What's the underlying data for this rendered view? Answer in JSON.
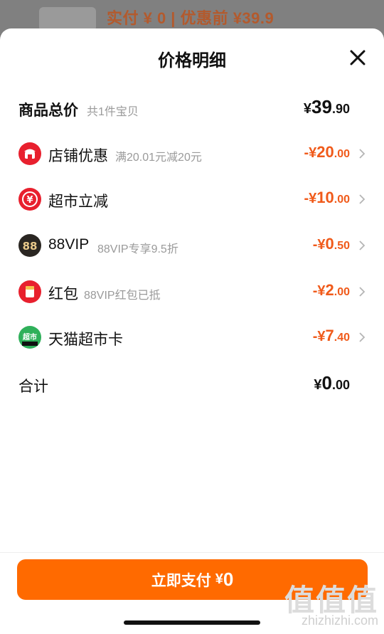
{
  "background": {
    "pay_text": "实付 ¥ 0 | 优惠前 ¥39.9"
  },
  "sheet": {
    "title": "价格明细",
    "close_icon": "close-icon"
  },
  "subtotal": {
    "label": "商品总价",
    "sub": "共1件宝贝",
    "currency": "¥",
    "int": "39",
    "dec": ".90"
  },
  "discounts": [
    {
      "icon": "shop-icon",
      "label": "店铺优惠",
      "sub": "满20.01元减20元",
      "prefix": "-¥",
      "int": "20",
      "dec": ".00",
      "color": "#e8202e"
    },
    {
      "icon": "yen-icon",
      "label": "超市立减",
      "sub": "",
      "prefix": "-¥",
      "int": "10",
      "dec": ".00",
      "color": "#e8202e"
    },
    {
      "icon": "vip88-icon",
      "label": "88VIP",
      "sub": "88VIP专享9.5折",
      "prefix": "-¥",
      "int": "0",
      "dec": ".50",
      "color": "#2a2622"
    },
    {
      "icon": "red-packet-icon",
      "label": "红包",
      "sub": "88VIP红包已抵",
      "prefix": "-¥",
      "int": "2",
      "dec": ".00",
      "color": "#e8202e"
    },
    {
      "icon": "tmall-card-icon",
      "label": "天猫超市卡",
      "sub": "",
      "prefix": "-¥",
      "int": "7",
      "dec": ".40",
      "color": "#2fb05a"
    }
  ],
  "total": {
    "label": "合计",
    "currency": "¥",
    "int": "0",
    "dec": ".00"
  },
  "pay_button": {
    "label": "立即支付",
    "currency": "¥",
    "amount": "0"
  },
  "watermark": {
    "logo": "值值值",
    "url": "zhizhizhi.com"
  },
  "colors": {
    "accent": "#ff6a00",
    "discount": "#f05a1a"
  }
}
